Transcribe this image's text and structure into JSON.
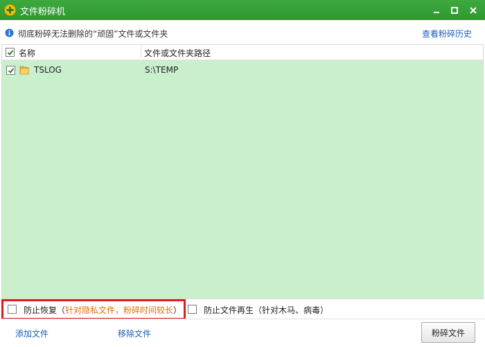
{
  "window": {
    "title": "文件粉碎机",
    "app_icon": "shredder-app-icon",
    "controls": [
      "minimize-icon",
      "maximize-icon",
      "close-icon"
    ]
  },
  "info": {
    "icon": "info-icon",
    "text": "彻底粉碎无法删除的“顽固”文件或文件夹",
    "history_link": "查看粉碎历史"
  },
  "list": {
    "header_checked": true,
    "columns": {
      "name": "名称",
      "path": "文件或文件夹路径"
    },
    "rows": [
      {
        "checked": true,
        "icon": "folder-icon",
        "name": "TSLOG",
        "path": "S:\\TEMP"
      }
    ]
  },
  "options": {
    "prevent_recovery": {
      "checked": false,
      "label": "防止恢复",
      "note_open": "（",
      "note": "针对隐私文件，粉碎时间较长",
      "note_close": "）"
    },
    "prevent_regen": {
      "checked": false,
      "label": "防止文件再生（针对木马、病毒）"
    }
  },
  "actions": {
    "add_file": "添加文件",
    "remove_file": "移除文件",
    "shred_button": "粉碎文件"
  },
  "colors": {
    "titlebar": "#2c9a30",
    "list_bg": "#c9efcc",
    "link": "#1a5fb4",
    "note_orange": "#e07000",
    "highlight": "#e41a1a"
  }
}
